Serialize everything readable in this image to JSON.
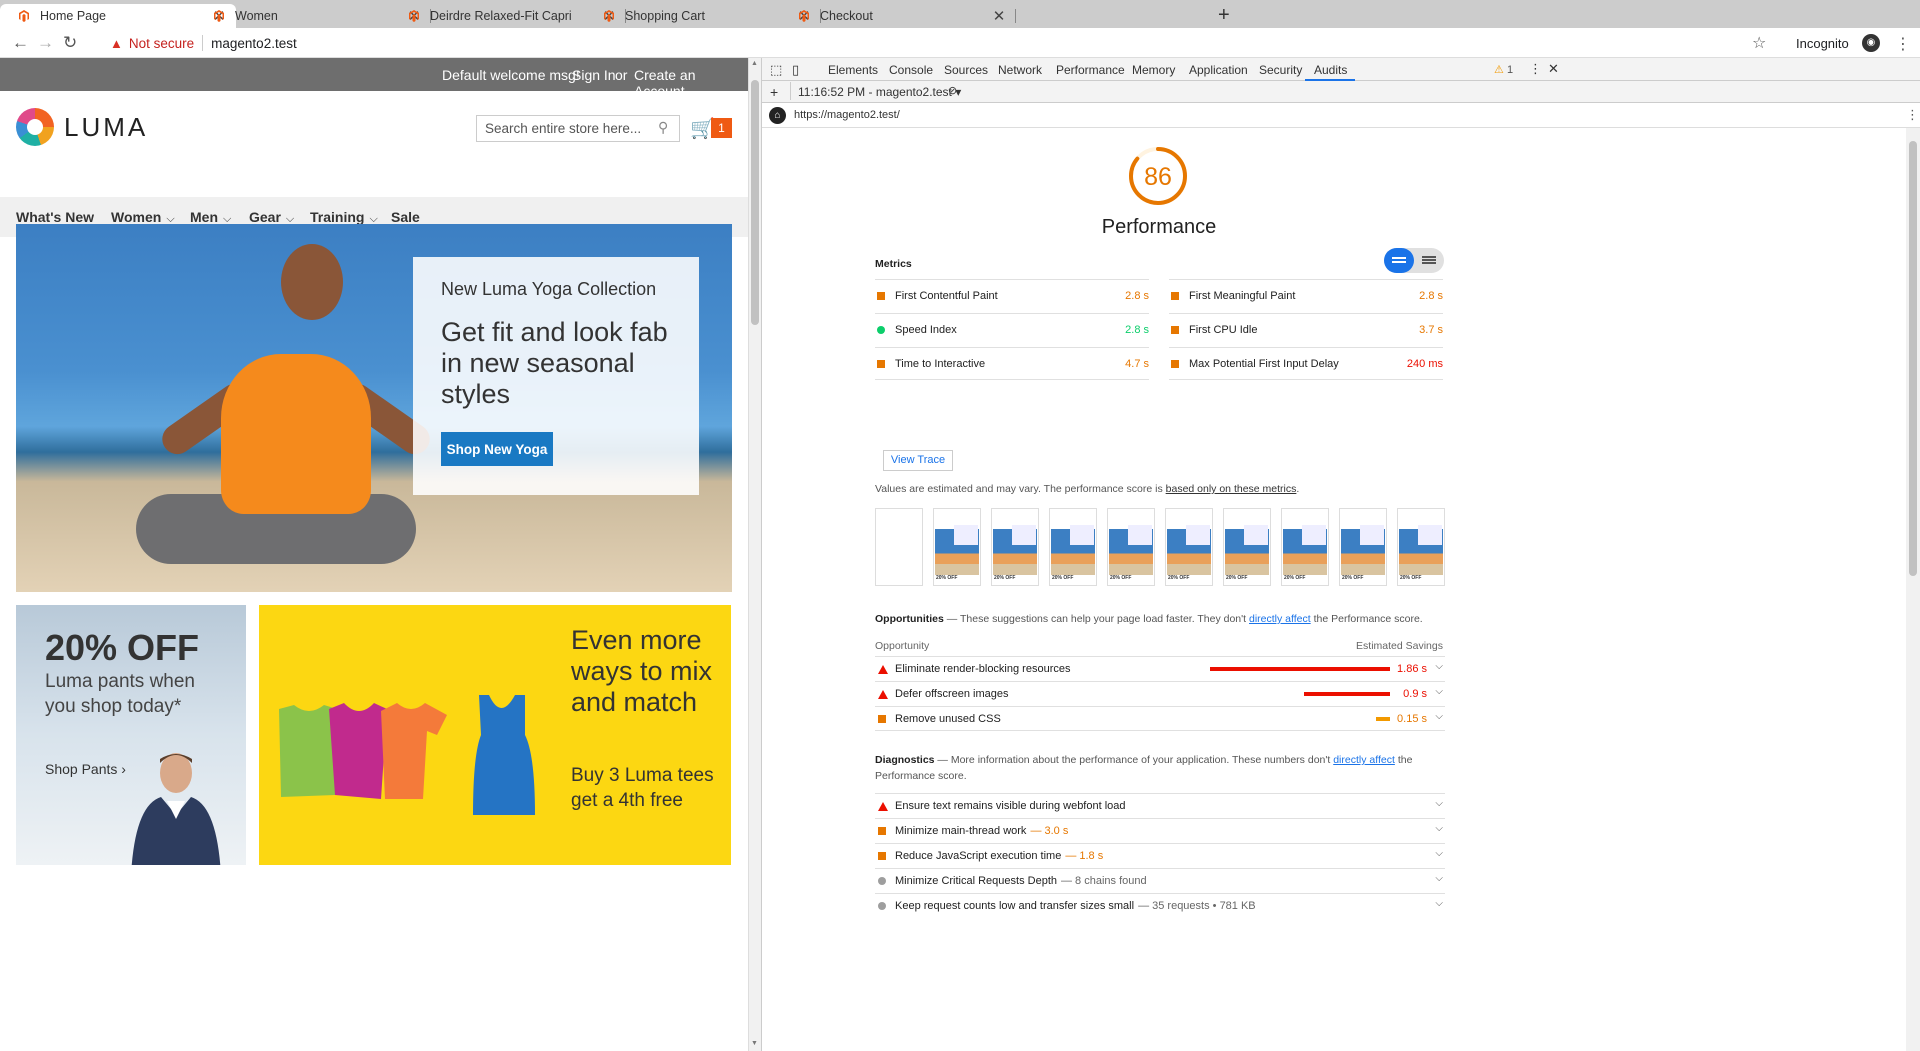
{
  "browser": {
    "tabs": [
      {
        "title": "Home Page",
        "active": true
      },
      {
        "title": "Women",
        "active": false
      },
      {
        "title": "Deirdre Relaxed-Fit Capri",
        "active": false
      },
      {
        "title": "Shopping Cart",
        "active": false
      },
      {
        "title": "Checkout",
        "active": false
      }
    ],
    "new_tab": "+",
    "security_label": "Not secure",
    "url": "magento2.test",
    "profile_label": "Incognito"
  },
  "site": {
    "welcome": "Default welcome msg!",
    "sign_in": "Sign In",
    "or": "or",
    "create_account": "Create an Account",
    "logo_text": "LUMA",
    "search_placeholder": "Search entire store here...",
    "cart_count": "1",
    "nav": [
      {
        "label": "What's New",
        "has_menu": false
      },
      {
        "label": "Women",
        "has_menu": true
      },
      {
        "label": "Men",
        "has_menu": true
      },
      {
        "label": "Gear",
        "has_menu": true
      },
      {
        "label": "Training",
        "has_menu": true
      },
      {
        "label": "Sale",
        "has_menu": false
      }
    ],
    "hero": {
      "kicker": "New Luma Yoga Collection",
      "title": "Get fit and look fab in new seasonal styles",
      "button": "Shop New Yoga"
    },
    "promo_pants": {
      "headline": "20% OFF",
      "sub": "Luma pants when you shop today*",
      "link": "Shop Pants"
    },
    "promo_tees": {
      "title": "Even more ways to mix and match",
      "sub": "Buy 3 Luma tees get a 4th free"
    }
  },
  "devtools": {
    "tabs": [
      "Elements",
      "Console",
      "Sources",
      "Network",
      "Performance",
      "Memory",
      "Application",
      "Security",
      "Audits"
    ],
    "active_tab": "Audits",
    "warning_count": "1",
    "report_selector": "11:16:52 PM - magento2.test",
    "audited_url": "https://magento2.test/",
    "report": {
      "score": "86",
      "score_fraction": 0.86,
      "category": "Performance",
      "metrics_header": "Metrics",
      "metrics": [
        {
          "label": "First Contentful Paint",
          "value": "2.8 s",
          "status": "average"
        },
        {
          "label": "First Meaningful Paint",
          "value": "2.8 s",
          "status": "average"
        },
        {
          "label": "Speed Index",
          "value": "2.8 s",
          "status": "pass"
        },
        {
          "label": "First CPU Idle",
          "value": "3.7 s",
          "status": "average"
        },
        {
          "label": "Time to Interactive",
          "value": "4.7 s",
          "status": "average"
        },
        {
          "label": "Max Potential First Input Delay",
          "value": "240 ms",
          "status": "average"
        }
      ],
      "view_trace": "View Trace",
      "estimate_note": "Values are estimated and may vary. The performance score is",
      "estimate_link": "based only on these metrics",
      "estimate_end": ".",
      "filmstrip_label": "20% OFF",
      "opportunities": {
        "title": "Opportunities",
        "desc": " — These suggestions can help your page load faster. They don't",
        "link": "directly affect",
        "desc_end": "the Performance score.",
        "col_opportunity": "Opportunity",
        "col_savings": "Estimated Savings",
        "items": [
          {
            "label": "Eliminate render-blocking resources",
            "value": "1.86 s",
            "status": "fail",
            "fraction": 1.0
          },
          {
            "label": "Defer offscreen images",
            "value": "0.9 s",
            "status": "fail",
            "fraction": 0.48
          },
          {
            "label": "Remove unused CSS",
            "value": "0.15 s",
            "status": "average",
            "fraction": 0.08
          }
        ]
      },
      "diagnostics": {
        "title": "Diagnostics",
        "desc": " — More information about the performance of your application. These numbers don't",
        "link": "directly affect",
        "desc_end": "the Performance score.",
        "items": [
          {
            "label": "Ensure text remains visible during webfont load",
            "hint": "",
            "status": "fail"
          },
          {
            "label": "Minimize main-thread work",
            "hint": "— 3.0 s",
            "status": "average"
          },
          {
            "label": "Reduce JavaScript execution time",
            "hint": "— 1.8 s",
            "status": "average"
          },
          {
            "label": "Minimize Critical Requests Depth",
            "hint": "— 8 chains found",
            "status": "info"
          },
          {
            "label": "Keep request counts low and transfer sizes small",
            "hint": "— 35 requests • 781 KB",
            "status": "info"
          }
        ]
      }
    }
  },
  "colors": {
    "accent": "#1a73e8",
    "luma_blue": "#1979c3",
    "cart_orange": "#ef5a13",
    "average": "#e67700",
    "fail": "#eb0f00",
    "pass": "#0cce6b",
    "promo_yellow": "#fcd712"
  }
}
